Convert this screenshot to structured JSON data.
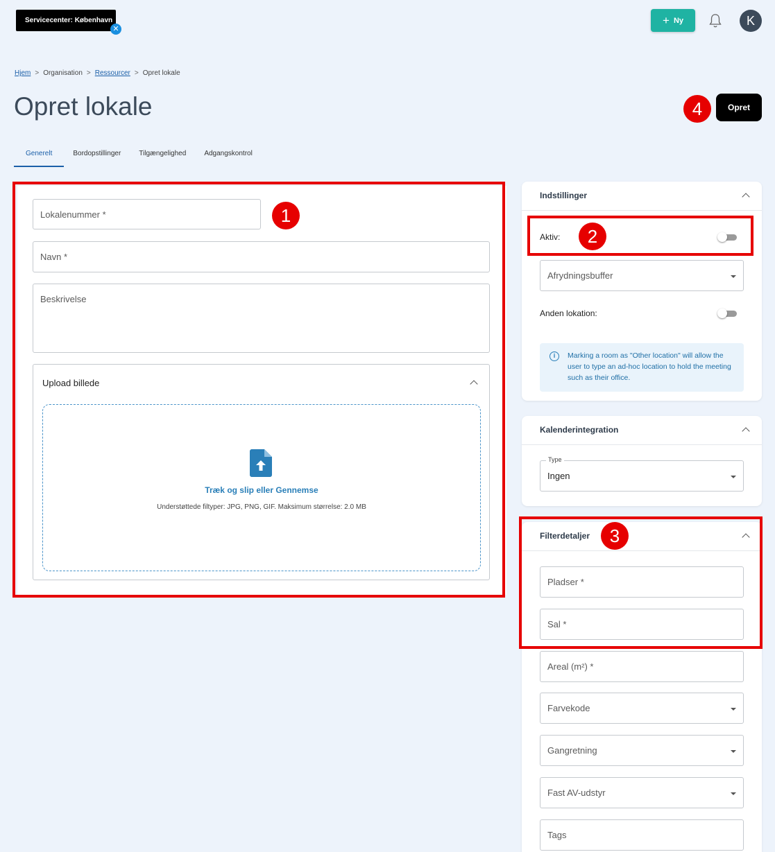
{
  "topbar": {
    "location_label": "Servicecenter: København",
    "location_close": "✕",
    "new_plus": "+",
    "new_label": "Ny",
    "avatar_initial": "K"
  },
  "breadcrumb": {
    "items": [
      "Hjem",
      "Organisation",
      "Ressourcer",
      "Opret lokale"
    ],
    "separator": ">"
  },
  "page": {
    "title": "Opret lokale",
    "create_label": "Opret"
  },
  "tabs": [
    "Generelt",
    "Bordopstillinger",
    "Tilgængelighed",
    "Adgangskontrol"
  ],
  "general": {
    "room_number_placeholder": "Lokalenummer *",
    "name_placeholder": "Navn *",
    "description_placeholder": "Beskrivelse",
    "upload": {
      "title": "Upload billede",
      "drop_label": "Træk og slip eller Gennemse",
      "hint": "Understøttede filtyper: JPG, PNG, GIF. Maksimum størrelse: 2.0 MB"
    }
  },
  "settings": {
    "title": "Indstillinger",
    "active_label": "Aktiv:",
    "active_on": false,
    "cleanup_buffer_placeholder": "Afrydningsbuffer",
    "other_location_label": "Anden lokation:",
    "other_location_on": false,
    "info_text": "Marking a room as \"Other location\" will allow the user to type an ad-hoc location to hold the meeting such as their office."
  },
  "calendar": {
    "title": "Kalenderintegration",
    "type_label": "Type",
    "type_value": "Ingen"
  },
  "filter": {
    "title": "Filterdetaljer",
    "seats_placeholder": "Pladser *",
    "hall_placeholder": "Sal *",
    "area_placeholder": "Areal (m²) *",
    "color_code_placeholder": "Farvekode",
    "direction_placeholder": "Gangretning",
    "av_equipment_placeholder": "Fast AV-udstyr",
    "tags_placeholder": "Tags"
  },
  "annotations": [
    "1",
    "2",
    "3",
    "4"
  ],
  "colors": {
    "accent": "#1b5fa8",
    "new_button": "#1fb3a3",
    "annotation_red": "#e60000",
    "background": "#edf3fb"
  }
}
